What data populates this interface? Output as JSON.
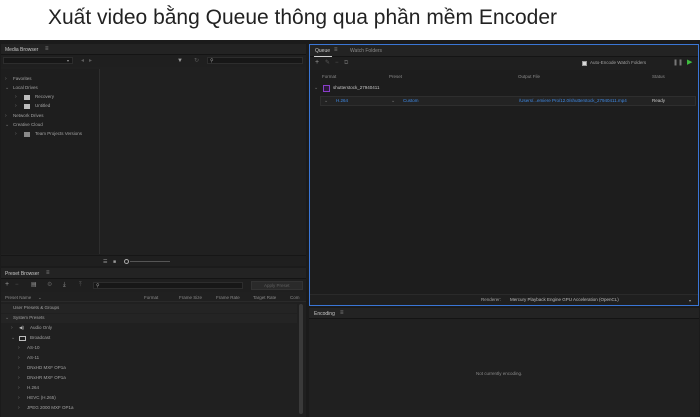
{
  "banner": {
    "title": "Xuất video bằng Queue thông qua phần mềm Encoder"
  },
  "media_browser": {
    "title": "Media Browser",
    "tree": {
      "favorites": "Favorites",
      "local_drives": "Local Drives",
      "recovery": "Recovery",
      "untitled": "Untitled",
      "network_drives": "Network Drives",
      "creative_cloud": "Creative Cloud",
      "team_projects": "Team Projects Versions"
    }
  },
  "queue": {
    "tabs": [
      "Queue",
      "Watch Folders"
    ],
    "auto_encode_label": "Auto-Encode Watch Folders",
    "columns": {
      "format": "Format",
      "preset": "Preset",
      "output_file": "Output File",
      "status": "Status"
    },
    "item": {
      "name": "shutterstock_27940411",
      "format": "H.264",
      "preset": "Custom",
      "output": "/Users/...emiere Pro/12.0/shutterstock_27940411.mp4",
      "status": "Ready"
    },
    "renderer_label": "Renderer:",
    "renderer_value": "Mercury Playback Engine GPU Acceleration (OpenCL)"
  },
  "preset_browser": {
    "title": "Preset Browser",
    "apply_label": "Apply Preset",
    "columns": {
      "name": "Preset Name",
      "format": "Format",
      "frame_size": "Frame Size",
      "frame_rate": "Frame Rate",
      "target_rate": "Target Rate",
      "comment": "Com"
    },
    "items": [
      {
        "label": "User Presets & Groups",
        "level": 0,
        "expand": ""
      },
      {
        "label": "System Presets",
        "level": 0,
        "expand": "v"
      },
      {
        "label": "Audio Only",
        "level": 1,
        "expand": ">"
      },
      {
        "label": "Broadcast",
        "level": 1,
        "expand": "v"
      },
      {
        "label": "AS-10",
        "level": 2,
        "expand": ">"
      },
      {
        "label": "AS-11",
        "level": 2,
        "expand": ">"
      },
      {
        "label": "DNxHD MXF OP1a",
        "level": 2,
        "expand": ">"
      },
      {
        "label": "DNxHR MXF OP1a",
        "level": 2,
        "expand": ">"
      },
      {
        "label": "H.264",
        "level": 2,
        "expand": ">"
      },
      {
        "label": "HEVC (H.265)",
        "level": 2,
        "expand": ">"
      },
      {
        "label": "JPEG 2000 MXF OP1a",
        "level": 2,
        "expand": ">"
      }
    ]
  },
  "encoding": {
    "title": "Encoding",
    "empty_message": "Not currently encoding."
  }
}
